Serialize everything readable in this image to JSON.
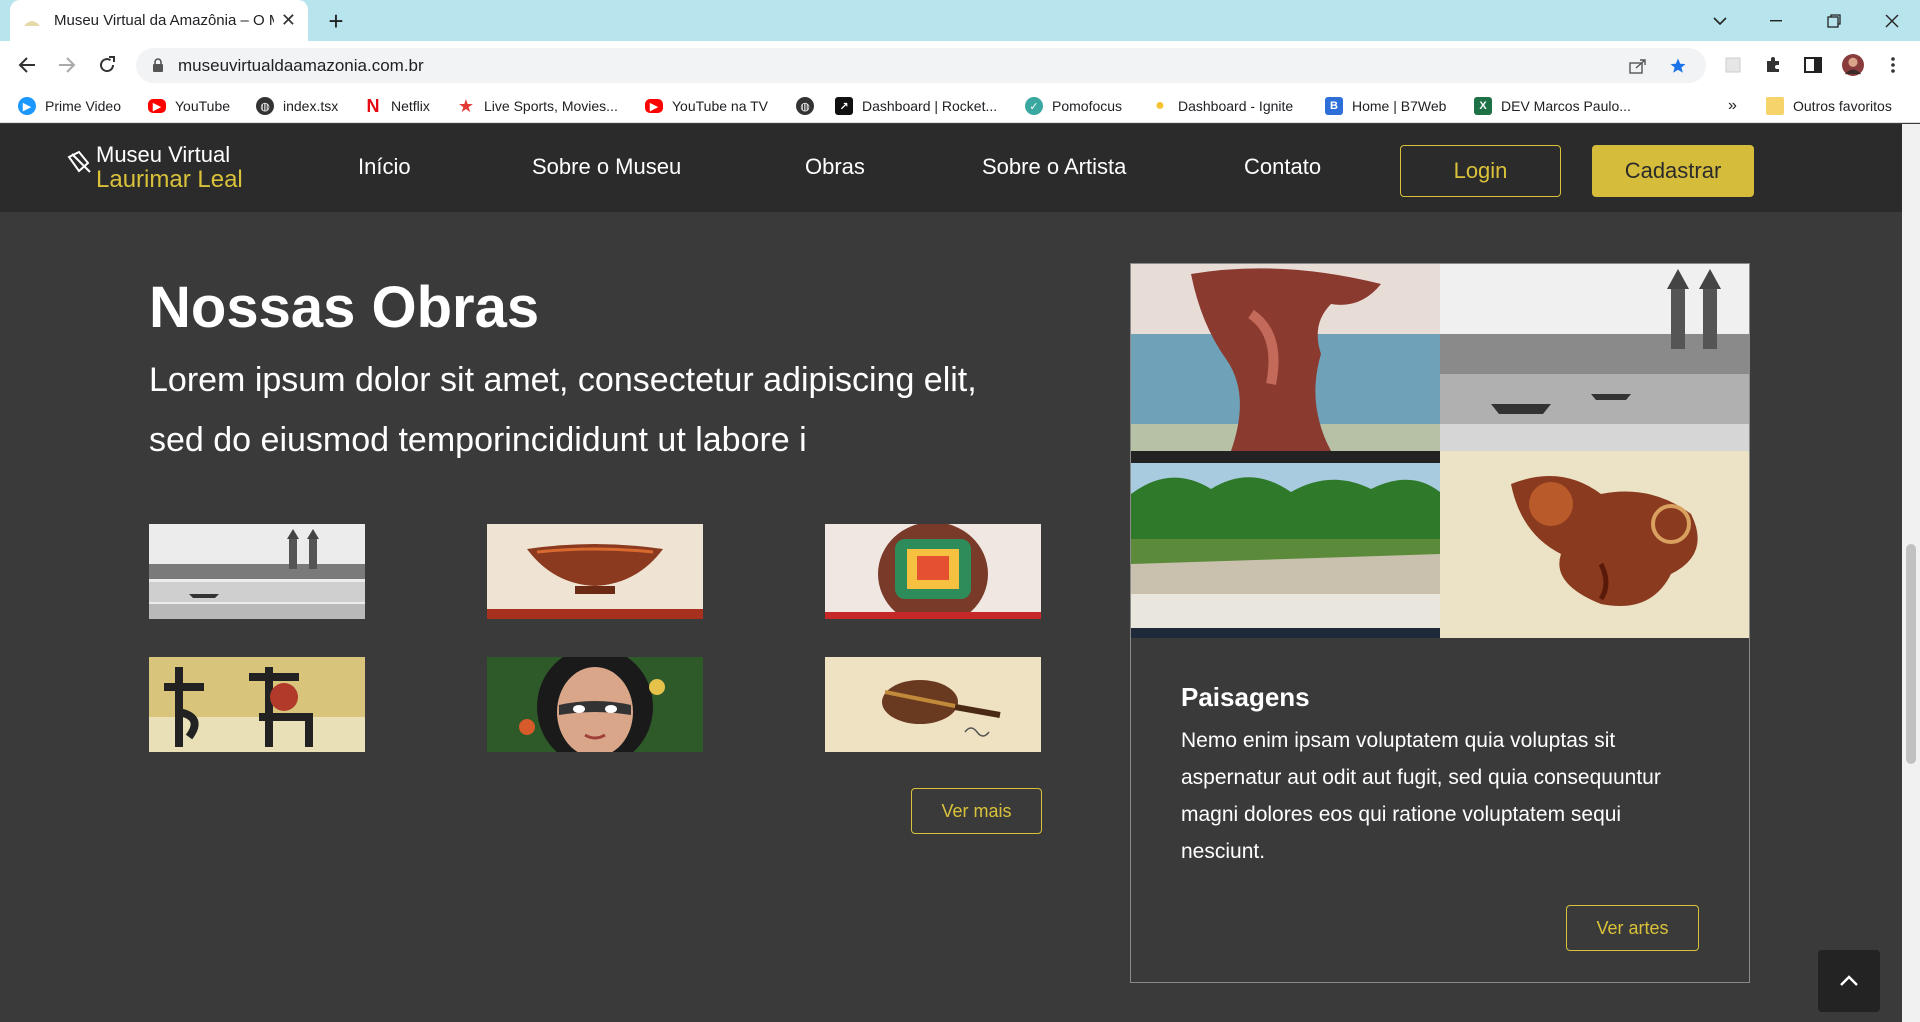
{
  "browser": {
    "tab_title": "Museu Virtual da Amazônia – O M",
    "url": "museuvirtualdaamazonia.com.br",
    "bookmarks": [
      {
        "label": "Prime Video",
        "icon": "prime-video-icon",
        "color": "#1a98ff"
      },
      {
        "label": "YouTube",
        "icon": "youtube-icon",
        "color": "#ff0000"
      },
      {
        "label": "index.tsx",
        "icon": "globe-icon",
        "color": "#333333"
      },
      {
        "label": "Netflix",
        "icon": "netflix-icon",
        "color": "#e50914"
      },
      {
        "label": "Live Sports, Movies...",
        "icon": "star-icon",
        "color": "#e53935"
      },
      {
        "label": "YouTube na TV",
        "icon": "youtube-icon",
        "color": "#ff0000"
      },
      {
        "label": "",
        "icon": "globe-icon",
        "color": "#333333"
      },
      {
        "label": "Dashboard | Rocket...",
        "icon": "rocketseat-icon",
        "color": "#111111"
      },
      {
        "label": "Pomofocus",
        "icon": "check-icon",
        "color": "#3aa8a0"
      },
      {
        "label": "Dashboard - Ignite",
        "icon": "bulb-icon",
        "color": "#f4c430"
      },
      {
        "label": "Home | B7Web",
        "icon": "b7web-icon",
        "color": "#2d6fd6"
      },
      {
        "label": "DEV Marcos Paulo...",
        "icon": "excel-icon",
        "color": "#1e7145"
      }
    ],
    "more_bookmarks": "»",
    "other_favorites": "Outros favoritos"
  },
  "site": {
    "logo_line1": "Museu Virtual",
    "logo_line2": "Laurimar Leal",
    "nav": [
      "Início",
      "Sobre o Museu",
      "Obras",
      "Sobre o Artista",
      "Contato"
    ],
    "login": "Login",
    "signup": "Cadastrar",
    "accent_color": "#d5bd3b"
  },
  "section": {
    "title": "Nossas Obras",
    "lead": "Lorem ipsum dolor sit amet, consectetur adipiscing elit, sed do eiusmod temporincididunt ut labore i",
    "ver_mais": "Ver mais"
  },
  "card": {
    "title": "Paisagens",
    "text": "Nemo enim ipsam voluptatem quia voluptas sit aspernatur aut odit aut fugit, sed quia consequuntur magni dolores eos qui ratione voluptatem sequi nesciunt.",
    "button": "Ver artes"
  }
}
